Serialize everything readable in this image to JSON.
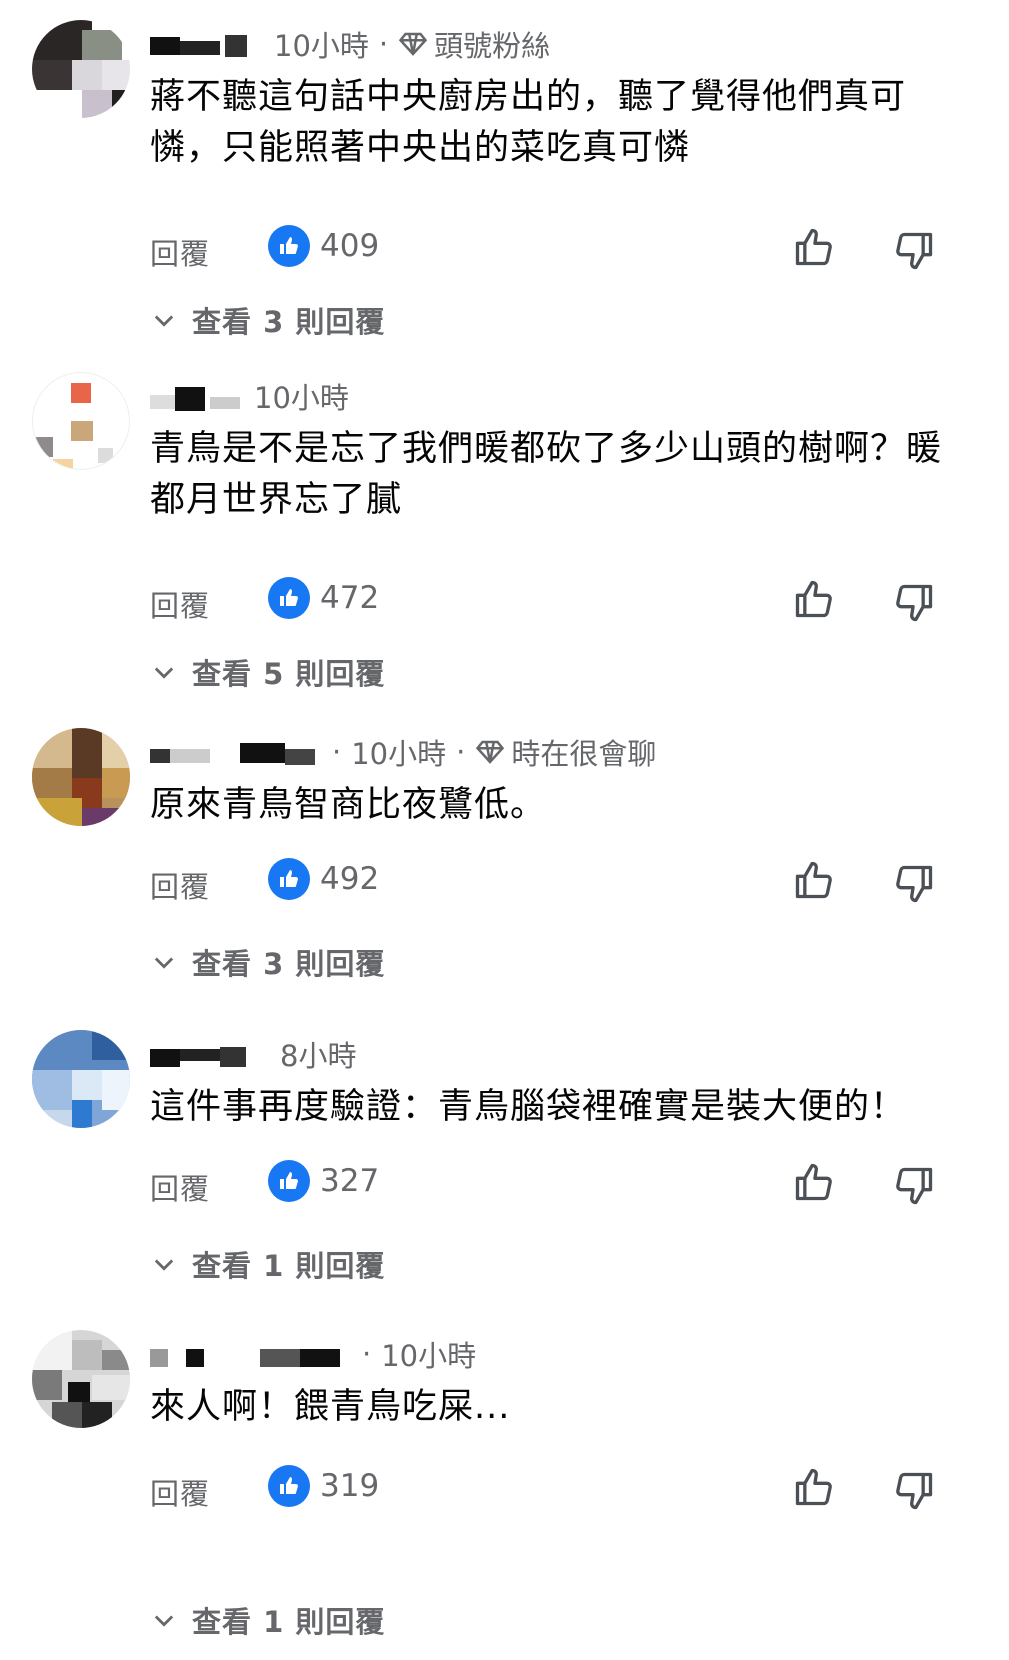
{
  "comments": [
    {
      "time": "10小時",
      "badge": "頭號粉絲",
      "text": "蔣不聽這句話中央廚房出的，聽了覺得他們真可憐，只能照著中央出的菜吃真可憐",
      "reply_label": "回覆",
      "likes": "409",
      "view_replies": "查看 3 則回覆"
    },
    {
      "time": "10小時",
      "badge": "",
      "text": "青鳥是不是忘了我們暖都砍了多少山頭的樹啊？暖都月世界忘了膩",
      "reply_label": "回覆",
      "likes": "472",
      "view_replies": "查看 5 則回覆"
    },
    {
      "time": "10小時",
      "badge": "時在很會聊",
      "text": "原來青鳥智商比夜鷺低。",
      "reply_label": "回覆",
      "likes": "492",
      "view_replies": "查看 3 則回覆"
    },
    {
      "time": "8小時",
      "badge": "",
      "text": "這件事再度驗證：青鳥腦袋裡確實是裝大便的！",
      "reply_label": "回覆",
      "likes": "327",
      "view_replies": "查看 1 則回覆"
    },
    {
      "time": "10小時",
      "badge": "",
      "text": "來人啊！餵青鳥吃屎...",
      "reply_label": "回覆",
      "likes": "319",
      "view_replies": "查看 1 則回覆"
    }
  ],
  "colors": {
    "like_blue": "#1877f2",
    "secondary_text": "#65676b",
    "primary_text": "#050505"
  },
  "icons": {
    "badge": "diamond-icon",
    "like": "like-badge-icon",
    "thumb_up": "thumb-up-icon",
    "thumb_down": "thumb-down-icon",
    "expand": "chevron-down-icon"
  }
}
